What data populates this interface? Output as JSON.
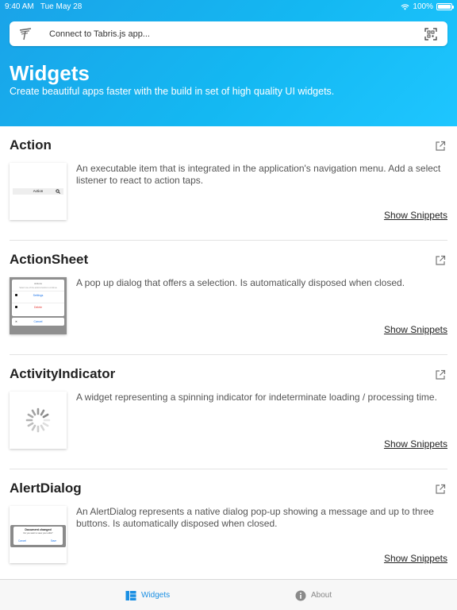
{
  "status_bar": {
    "time": "9:40 AM",
    "date": "Tue May 28",
    "battery": "100%",
    "battery_level": 1.0
  },
  "connect_bar": {
    "placeholder": "Connect to Tabris.js app...",
    "logo_icon": "tabris-logo-icon",
    "scan_icon": "qr-scan-icon"
  },
  "header": {
    "title": "Widgets",
    "subtitle": "Create beautiful apps faster with the build in set of high quality UI widgets."
  },
  "widgets": [
    {
      "name": "Action",
      "description": "An executable item that is integrated in the application's navigation menu. Add a select listener to react to action taps.",
      "snippets_label": "Show Snippets"
    },
    {
      "name": "ActionSheet",
      "description": "A pop up dialog that offers a selection. Is automatically disposed when closed.",
      "snippets_label": "Show Snippets"
    },
    {
      "name": "ActivityIndicator",
      "description": "A widget representing a spinning indicator for indeterminate loading / processing time.",
      "snippets_label": "Show Snippets"
    },
    {
      "name": "AlertDialog",
      "description": "An AlertDialog represents a native dialog pop-up showing a message and up to three buttons.  Is automatically disposed when closed.",
      "snippets_label": "Show Snippets"
    }
  ],
  "thumbnails": {
    "action": {
      "label": "Action"
    },
    "action_sheet": {
      "title": "Actions",
      "subtitle": "Select one of the actions below to continue",
      "items": [
        "Settings",
        "Delete"
      ],
      "cancel": "Cancel"
    },
    "alert": {
      "title": "Document changed",
      "message": "Do you want to save your edits?",
      "buttons": [
        "Cancel",
        "Save"
      ]
    }
  },
  "tab_bar": {
    "tabs": [
      {
        "label": "Widgets",
        "icon": "widgets-grid-icon",
        "active": true
      },
      {
        "label": "About",
        "icon": "info-icon",
        "active": false
      }
    ]
  },
  "colors": {
    "accent": "#1a8fe3",
    "hero_start": "#1aa3e8",
    "hero_end": "#1ec6ff",
    "delete": "#e53935"
  }
}
